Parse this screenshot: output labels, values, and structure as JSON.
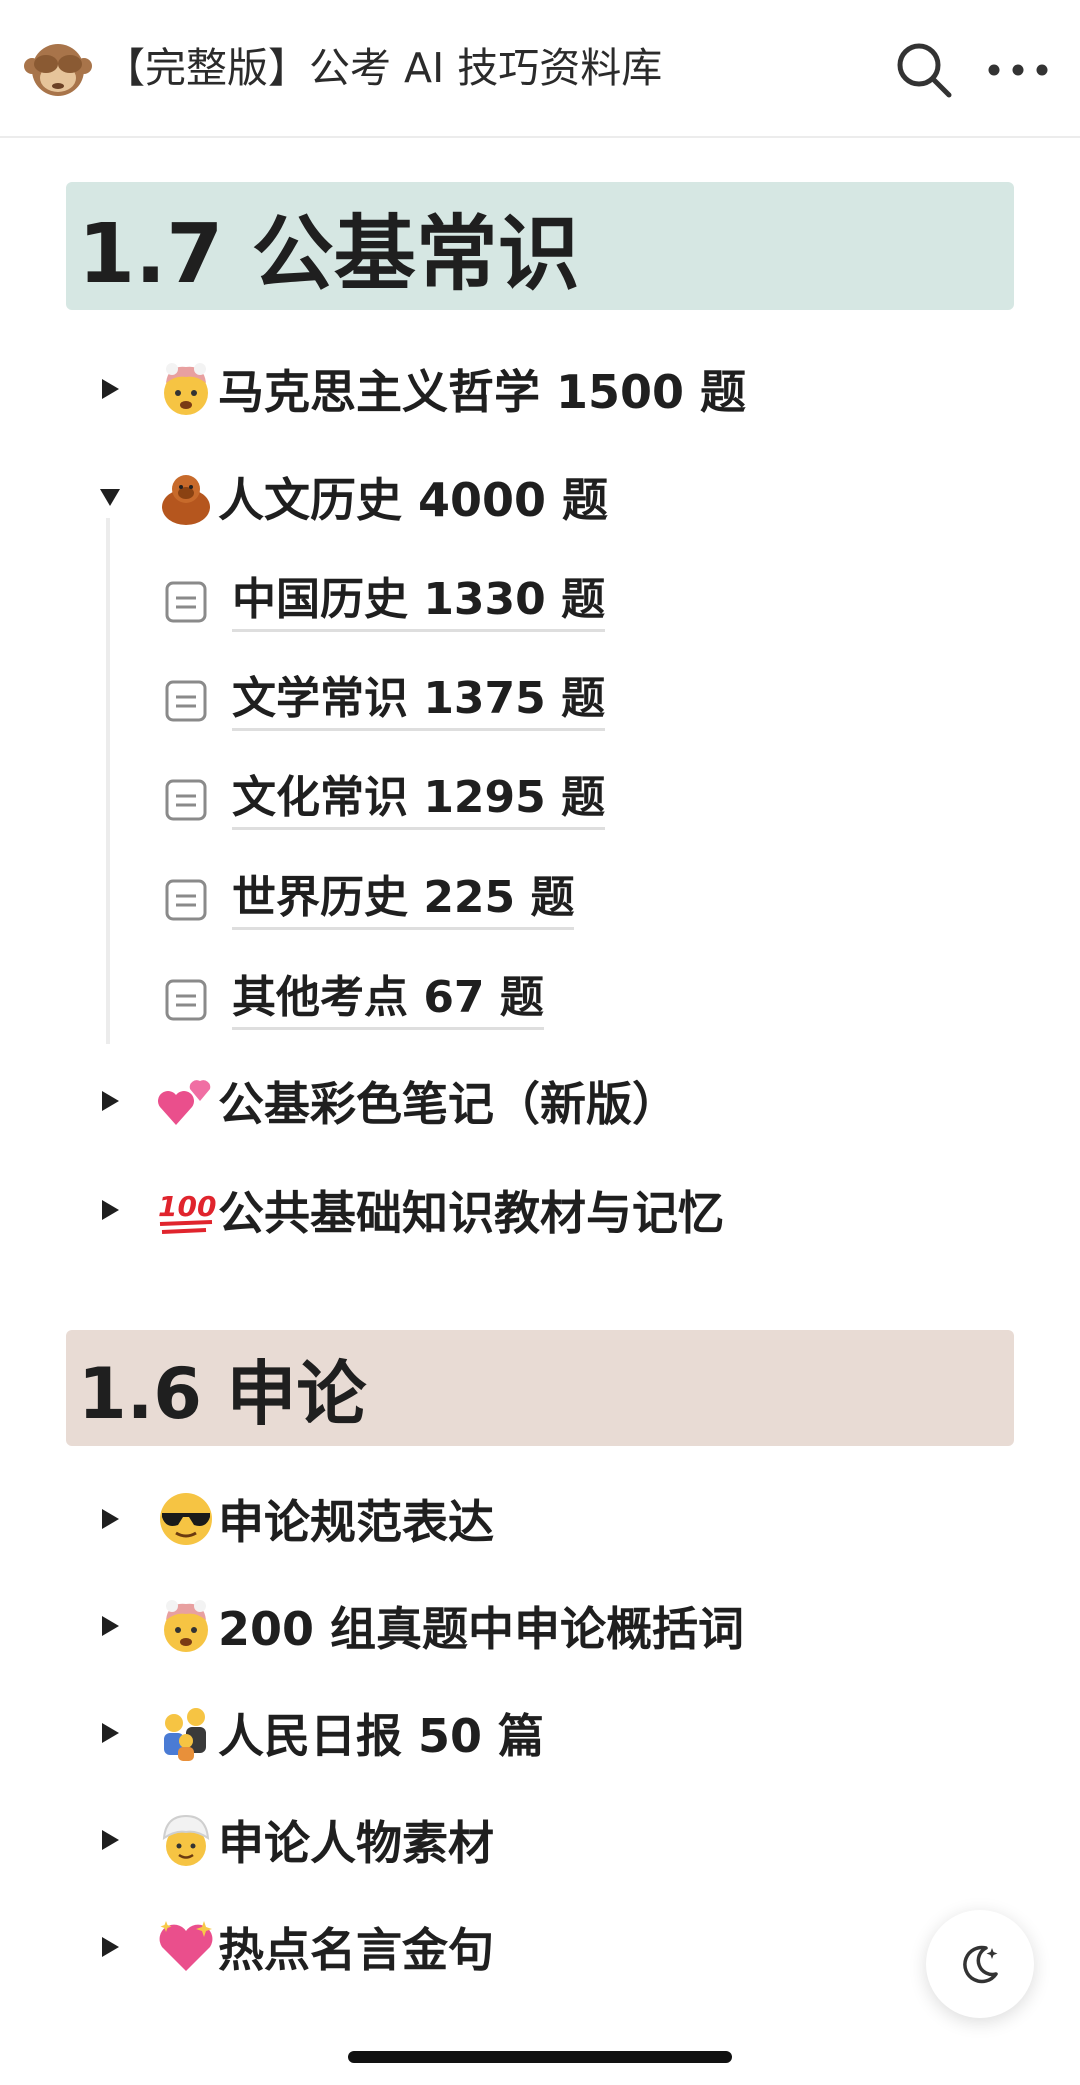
{
  "topbar": {
    "title": "【完整版】公考 AI 技巧资料库",
    "page_icon": "see-no-evil-monkey-icon",
    "actions": [
      "search-icon",
      "more-icon"
    ]
  },
  "section_1_7": {
    "heading": "1.7 公基常识",
    "heading_bg": "#d6e7e3",
    "toggles": [
      {
        "icon": "exploding-head-emoji",
        "label": "马克思主义哲学 1500 题",
        "expanded": false
      },
      {
        "icon": "orangutan-emoji",
        "label": "人文历史 4000 题",
        "expanded": true,
        "children": [
          {
            "label": "中国历史 1330 题"
          },
          {
            "label": "文学常识 1375 题"
          },
          {
            "label": "文化常识 1295 题"
          },
          {
            "label": "世界历史 225 题"
          },
          {
            "label": "其他考点 67 题"
          }
        ]
      },
      {
        "icon": "two-hearts-emoji",
        "label": "公基彩色笔记（新版）",
        "expanded": false
      },
      {
        "icon": "hundred-points-emoji",
        "label": "公共基础知识教材与记忆",
        "expanded": false
      }
    ]
  },
  "section_1_6": {
    "heading": "1.6 申论",
    "heading_bg": "#e8dbd4",
    "toggles": [
      {
        "icon": "sunglasses-face-emoji",
        "label": "申论规范表达",
        "expanded": false
      },
      {
        "icon": "exploding-head-emoji",
        "label": "200 组真题中申论概括词",
        "expanded": false
      },
      {
        "icon": "family-emoji",
        "label": "人民日报 50 篇",
        "expanded": false
      },
      {
        "icon": "person-turban-emoji",
        "label": "申论人物素材",
        "expanded": false
      },
      {
        "icon": "sparkling-heart-emoji",
        "label": "热点名言金句",
        "expanded": false
      }
    ]
  },
  "floating": {
    "night_mode": "moon-stars-icon"
  }
}
